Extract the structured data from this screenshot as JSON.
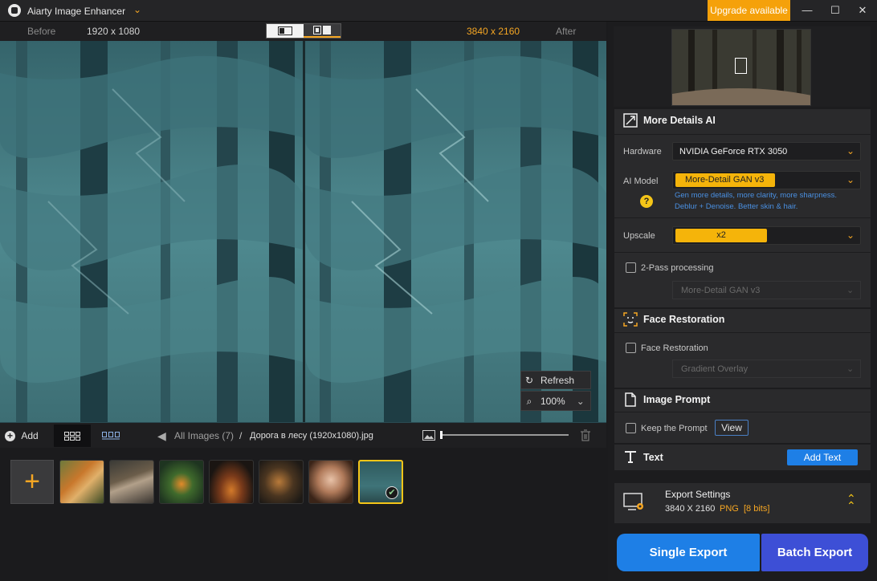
{
  "app": {
    "title": "Aiarty Image Enhancer",
    "upgrade_label": "Upgrade available"
  },
  "viewer": {
    "before_label": "Before",
    "before_res": "1920 x 1080",
    "after_res": "3840 x 2160",
    "after_label": "After",
    "refresh_label": "Refresh",
    "zoom": "100%"
  },
  "strip": {
    "add_label": "Add",
    "all_images": "All Images (7)",
    "separator": "/",
    "filename": "Дорога в лесу (1920x1080).jpg"
  },
  "panel": {
    "more_details": {
      "title": "More Details AI",
      "hardware_label": "Hardware",
      "hardware_value": "NVIDIA GeForce RTX 3050",
      "model_label": "AI Model",
      "model_value": "More-Detail GAN  v3",
      "model_desc_1": "Gen more details, more clarity, more sharpness.",
      "model_desc_2": "Deblur + Denoise. Better skin & hair.",
      "upscale_label": "Upscale",
      "upscale_value": "x2",
      "twopass_label": "2-Pass processing",
      "twopass_model": "More-Detail GAN  v3"
    },
    "face": {
      "title": "Face Restoration",
      "check_label": "Face Restoration",
      "mode": "Gradient Overlay"
    },
    "prompt": {
      "title": "Image Prompt",
      "keep_label": "Keep the Prompt",
      "view_label": "View"
    },
    "text": {
      "title": "Text",
      "add_label": "Add Text"
    },
    "export": {
      "title": "Export Settings",
      "res": "3840 X 2160",
      "format": "PNG",
      "bits": "[8 bits]",
      "single_label": "Single Export",
      "batch_label": "Batch Export"
    }
  },
  "colors": {
    "accent": "#f5a623",
    "primary_blue": "#1e7fe6",
    "batch_blue": "#3d4fd6"
  }
}
